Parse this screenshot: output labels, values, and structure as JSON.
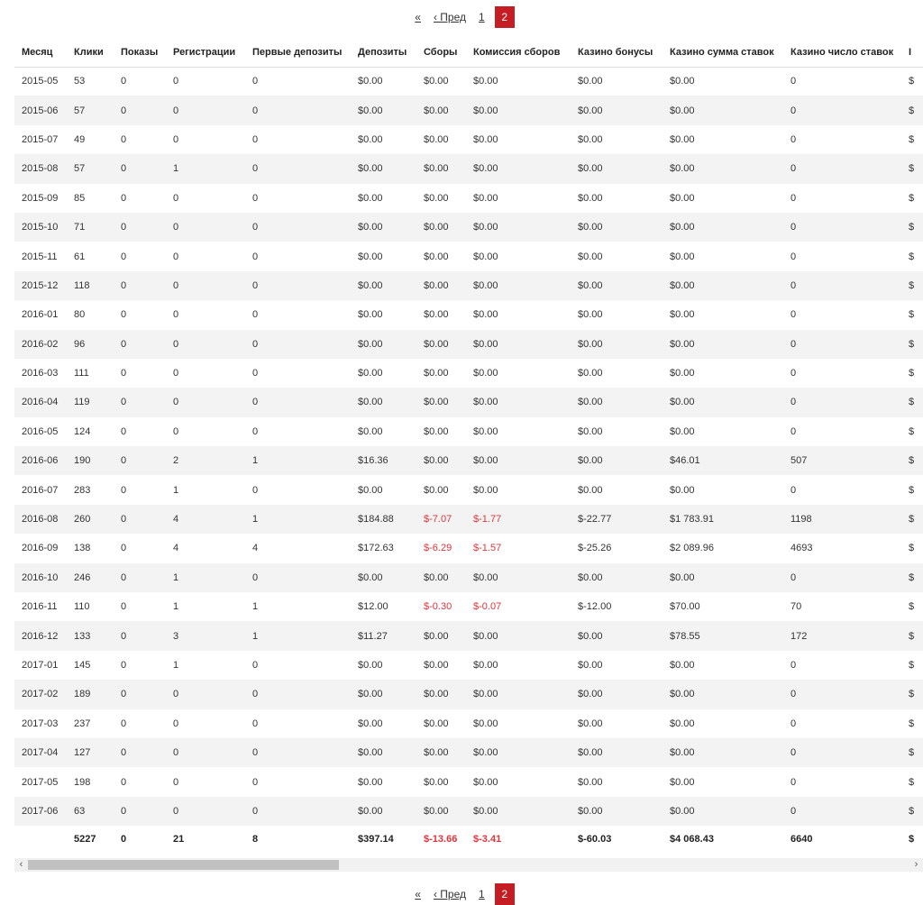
{
  "pager": {
    "first": "«",
    "prev": "‹ Пред",
    "page1": "1",
    "current": "2"
  },
  "table": {
    "headers": [
      "Месяц",
      "Клики",
      "Показы",
      "Регистрации",
      "Первые депозиты",
      "Депозиты",
      "Сборы",
      "Комиссия сборов",
      "Казино бонусы",
      "Казино сумма ставок",
      "Казино число ставок",
      "I"
    ],
    "rows": [
      [
        "2015-05",
        "53",
        "0",
        "0",
        "0",
        "$0.00",
        "$0.00",
        "$0.00",
        "$0.00",
        "$0.00",
        "0",
        "$"
      ],
      [
        "2015-06",
        "57",
        "0",
        "0",
        "0",
        "$0.00",
        "$0.00",
        "$0.00",
        "$0.00",
        "$0.00",
        "0",
        "$"
      ],
      [
        "2015-07",
        "49",
        "0",
        "0",
        "0",
        "$0.00",
        "$0.00",
        "$0.00",
        "$0.00",
        "$0.00",
        "0",
        "$"
      ],
      [
        "2015-08",
        "57",
        "0",
        "1",
        "0",
        "$0.00",
        "$0.00",
        "$0.00",
        "$0.00",
        "$0.00",
        "0",
        "$"
      ],
      [
        "2015-09",
        "85",
        "0",
        "0",
        "0",
        "$0.00",
        "$0.00",
        "$0.00",
        "$0.00",
        "$0.00",
        "0",
        "$"
      ],
      [
        "2015-10",
        "71",
        "0",
        "0",
        "0",
        "$0.00",
        "$0.00",
        "$0.00",
        "$0.00",
        "$0.00",
        "0",
        "$"
      ],
      [
        "2015-11",
        "61",
        "0",
        "0",
        "0",
        "$0.00",
        "$0.00",
        "$0.00",
        "$0.00",
        "$0.00",
        "0",
        "$"
      ],
      [
        "2015-12",
        "118",
        "0",
        "0",
        "0",
        "$0.00",
        "$0.00",
        "$0.00",
        "$0.00",
        "$0.00",
        "0",
        "$"
      ],
      [
        "2016-01",
        "80",
        "0",
        "0",
        "0",
        "$0.00",
        "$0.00",
        "$0.00",
        "$0.00",
        "$0.00",
        "0",
        "$"
      ],
      [
        "2016-02",
        "96",
        "0",
        "0",
        "0",
        "$0.00",
        "$0.00",
        "$0.00",
        "$0.00",
        "$0.00",
        "0",
        "$"
      ],
      [
        "2016-03",
        "111",
        "0",
        "0",
        "0",
        "$0.00",
        "$0.00",
        "$0.00",
        "$0.00",
        "$0.00",
        "0",
        "$"
      ],
      [
        "2016-04",
        "119",
        "0",
        "0",
        "0",
        "$0.00",
        "$0.00",
        "$0.00",
        "$0.00",
        "$0.00",
        "0",
        "$"
      ],
      [
        "2016-05",
        "124",
        "0",
        "0",
        "0",
        "$0.00",
        "$0.00",
        "$0.00",
        "$0.00",
        "$0.00",
        "0",
        "$"
      ],
      [
        "2016-06",
        "190",
        "0",
        "2",
        "1",
        "$16.36",
        "$0.00",
        "$0.00",
        "$0.00",
        "$46.01",
        "507",
        "$"
      ],
      [
        "2016-07",
        "283",
        "0",
        "1",
        "0",
        "$0.00",
        "$0.00",
        "$0.00",
        "$0.00",
        "$0.00",
        "0",
        "$"
      ],
      [
        "2016-08",
        "260",
        "0",
        "4",
        "1",
        "$184.88",
        "$-7.07",
        "$-1.77",
        "$-22.77",
        "$1 783.91",
        "1198",
        "$"
      ],
      [
        "2016-09",
        "138",
        "0",
        "4",
        "4",
        "$172.63",
        "$-6.29",
        "$-1.57",
        "$-25.26",
        "$2 089.96",
        "4693",
        "$"
      ],
      [
        "2016-10",
        "246",
        "0",
        "1",
        "0",
        "$0.00",
        "$0.00",
        "$0.00",
        "$0.00",
        "$0.00",
        "0",
        "$"
      ],
      [
        "2016-11",
        "110",
        "0",
        "1",
        "1",
        "$12.00",
        "$-0.30",
        "$-0.07",
        "$-12.00",
        "$70.00",
        "70",
        "$"
      ],
      [
        "2016-12",
        "133",
        "0",
        "3",
        "1",
        "$11.27",
        "$0.00",
        "$0.00",
        "$0.00",
        "$78.55",
        "172",
        "$"
      ],
      [
        "2017-01",
        "145",
        "0",
        "1",
        "0",
        "$0.00",
        "$0.00",
        "$0.00",
        "$0.00",
        "$0.00",
        "0",
        "$"
      ],
      [
        "2017-02",
        "189",
        "0",
        "0",
        "0",
        "$0.00",
        "$0.00",
        "$0.00",
        "$0.00",
        "$0.00",
        "0",
        "$"
      ],
      [
        "2017-03",
        "237",
        "0",
        "0",
        "0",
        "$0.00",
        "$0.00",
        "$0.00",
        "$0.00",
        "$0.00",
        "0",
        "$"
      ],
      [
        "2017-04",
        "127",
        "0",
        "0",
        "0",
        "$0.00",
        "$0.00",
        "$0.00",
        "$0.00",
        "$0.00",
        "0",
        "$"
      ],
      [
        "2017-05",
        "198",
        "0",
        "0",
        "0",
        "$0.00",
        "$0.00",
        "$0.00",
        "$0.00",
        "$0.00",
        "0",
        "$"
      ],
      [
        "2017-06",
        "63",
        "0",
        "0",
        "0",
        "$0.00",
        "$0.00",
        "$0.00",
        "$0.00",
        "$0.00",
        "0",
        "$"
      ]
    ],
    "totals": [
      "",
      "5227",
      "0",
      "21",
      "8",
      "$397.14",
      "$-13.66",
      "$-3.41",
      "$-60.03",
      "$4 068.43",
      "6640",
      "$"
    ],
    "negative_color": "#e2333a"
  },
  "scrollbar": {
    "left_arrow": "‹",
    "right_arrow": "›"
  },
  "colors": {
    "accent": "#c41e24",
    "row_stripe": "#f3f3f3"
  }
}
